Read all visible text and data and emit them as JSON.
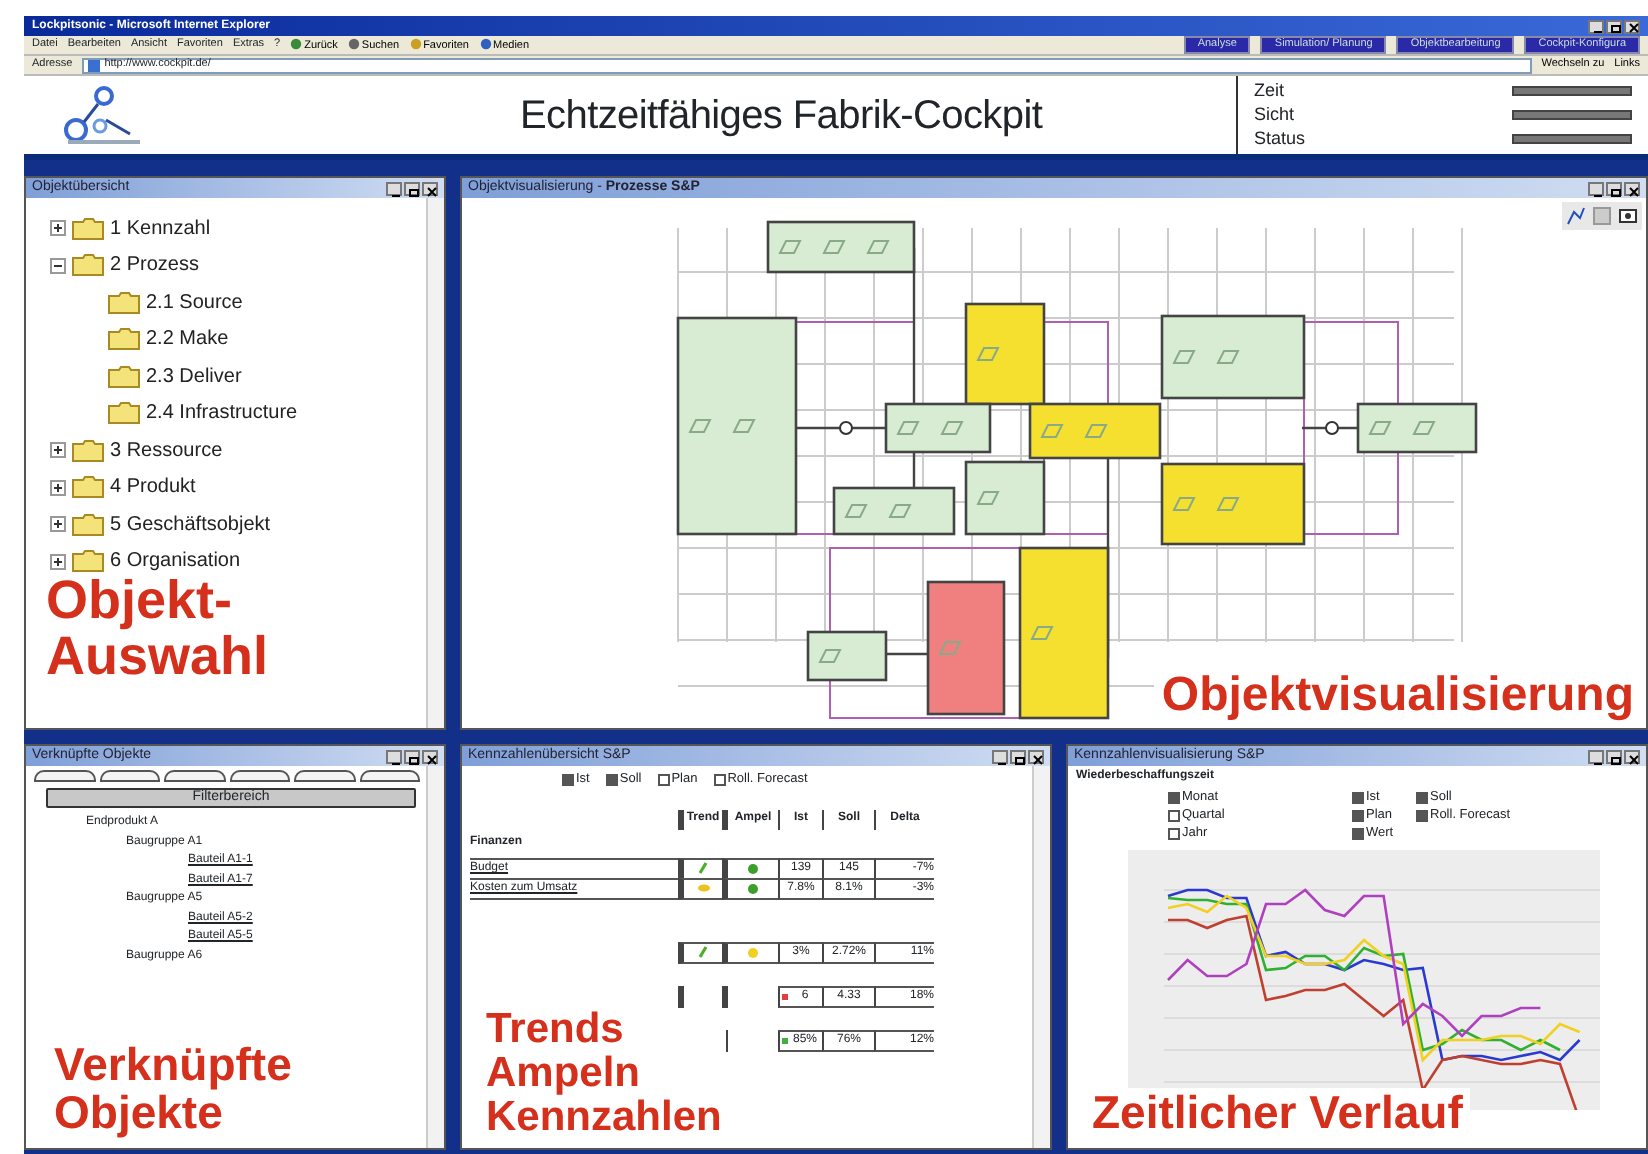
{
  "window": {
    "title": "Lockpitsonic - Microsoft Internet Explorer"
  },
  "menu": [
    "Datei",
    "Bearbeiten",
    "Ansicht",
    "Favoriten",
    "Extras",
    "?"
  ],
  "toolbar": [
    "Zurück",
    "Suchen",
    "Favoriten",
    "Medien"
  ],
  "nav_tabs": [
    {
      "label": "Analyse",
      "selected": false
    },
    {
      "label": "Simulation/ Planung",
      "selected": false
    },
    {
      "label": "Objektbearbeitung",
      "selected": false
    },
    {
      "label": "Cockpit-Konfigura",
      "selected": false
    }
  ],
  "address_bar": {
    "label": "Adresse",
    "value": "http://www.cockpit.de/",
    "go": "Wechseln zu",
    "links": "Links"
  },
  "header": {
    "title": "Echtzeitfähiges Fabrik-Cockpit",
    "fields": [
      "Zeit",
      "Sicht",
      "Status"
    ]
  },
  "object_tree": {
    "title": "Objektübersicht",
    "caption": "Objekt-Auswahl",
    "items": [
      {
        "label": "1 Kennzahl",
        "expanded": false
      },
      {
        "label": "2 Prozess",
        "expanded": true,
        "children": [
          {
            "label": "2.1 Source"
          },
          {
            "label": "2.2 Make"
          },
          {
            "label": "2.3 Deliver"
          },
          {
            "label": "2.4 Infrastructure"
          }
        ]
      },
      {
        "label": "3 Ressource",
        "expanded": false
      },
      {
        "label": "4 Produkt",
        "expanded": false
      },
      {
        "label": "5 Geschäftsobjekt",
        "expanded": false
      },
      {
        "label": "6 Organisation",
        "expanded": false
      }
    ]
  },
  "visualization": {
    "title": "Objektvisualisierung - ",
    "title_bold": "Prozesse S&P",
    "caption": "Objektvisualisierung"
  },
  "linked_objects": {
    "title": "Verknüpfte Objekte",
    "button": "Filterbereich",
    "caption": "Verknüpfte Objekte",
    "items": [
      {
        "label": "Endprodukt A",
        "children": [
          {
            "label": "Baugruppe A1",
            "children": [
              {
                "label": "Bauteil A1-1"
              },
              {
                "label": "Bauteil A1-7"
              }
            ]
          },
          {
            "label": "Baugruppe A5",
            "children": [
              {
                "label": "Bauteil A5-2"
              },
              {
                "label": "Bauteil A5-5"
              }
            ]
          },
          {
            "label": "Baugruppe A6"
          }
        ]
      }
    ]
  },
  "kpi_table": {
    "title": "Kennzahlenübersicht S&P",
    "caption": "Trends Ampeln Kennzahlen",
    "filters": [
      {
        "label": "Ist",
        "checked": true
      },
      {
        "label": "Soll",
        "checked": true
      },
      {
        "label": "Plan",
        "checked": false
      },
      {
        "label": "Roll. Forecast",
        "checked": false
      }
    ],
    "columns": [
      "Trend",
      "Ampel",
      "Ist",
      "Soll",
      "Delta"
    ],
    "group": "Finanzen",
    "rows": [
      {
        "label": "Budget",
        "trend": {
          "kind": "up",
          "color": "#4caf2a"
        },
        "ampel": {
          "color": "#3aa02a"
        },
        "ist": "139",
        "soll": "145",
        "delta": "-7%"
      },
      {
        "label": "Kosten zum Umsatz",
        "trend": {
          "kind": "flat",
          "color": "#f0c020"
        },
        "ampel": {
          "color": "#3aa02a"
        },
        "ist": "7.8%",
        "soll": "8.1%",
        "delta": "-3%"
      },
      {
        "trend": {
          "kind": "up",
          "color": "#4caf2a"
        },
        "ampel": {
          "color": "#f0d020"
        },
        "ist": "3%",
        "soll": "2.72%",
        "delta": "11%"
      },
      {
        "color": "#e04040",
        "ist": "6",
        "soll": "4.33",
        "delta": "18%"
      },
      {
        "color": "#40b040",
        "ist": "85%",
        "soll": "76%",
        "delta": "12%"
      }
    ]
  },
  "kpi_chart": {
    "title": "Kennzahlenvisualisierung S&P",
    "metric": "Wiederbeschaffungszeit",
    "caption": "Zeitlicher Verlauf",
    "periods": [
      {
        "label": "Monat",
        "checked": true
      },
      {
        "label": "Quartal",
        "checked": false
      },
      {
        "label": "Jahr",
        "checked": false
      }
    ],
    "series_filters": [
      {
        "label": "Ist",
        "checked": true
      },
      {
        "label": "Soll",
        "checked": true
      },
      {
        "label": "Plan",
        "checked": true
      },
      {
        "label": "Roll. Forecast",
        "checked": true
      },
      {
        "label": "Wert",
        "checked": true
      }
    ]
  }
}
